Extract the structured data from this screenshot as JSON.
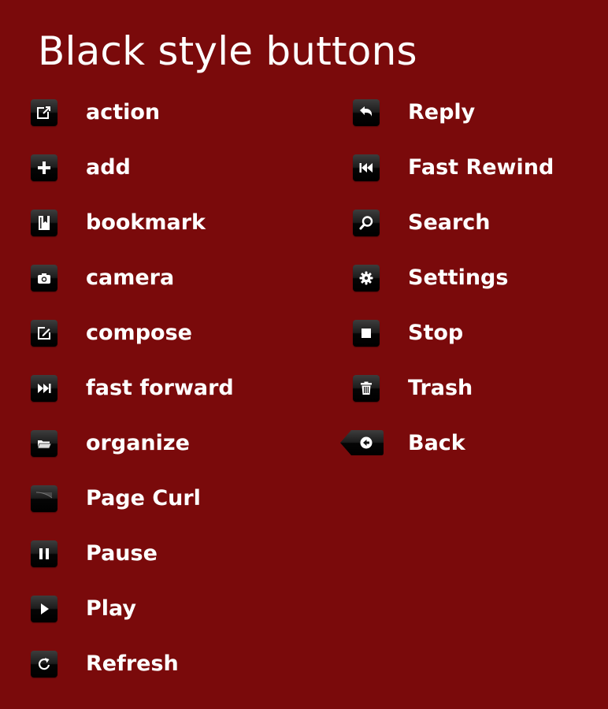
{
  "page": {
    "title": "Black style buttons",
    "background_color": "#7a0a0b"
  },
  "left_buttons": [
    {
      "label": "action",
      "icon": "action-icon"
    },
    {
      "label": "add",
      "icon": "add-icon"
    },
    {
      "label": "bookmark",
      "icon": "bookmark-icon"
    },
    {
      "label": "camera",
      "icon": "camera-icon"
    },
    {
      "label": "compose",
      "icon": "compose-icon"
    },
    {
      "label": "fast forward",
      "icon": "fast-forward-icon"
    },
    {
      "label": "organize",
      "icon": "organize-icon"
    },
    {
      "label": "Page Curl",
      "icon": "page-curl-icon"
    },
    {
      "label": "Pause",
      "icon": "pause-icon"
    },
    {
      "label": "Play",
      "icon": "play-icon"
    },
    {
      "label": "Refresh",
      "icon": "refresh-icon"
    }
  ],
  "right_buttons": [
    {
      "label": "Reply",
      "icon": "reply-icon"
    },
    {
      "label": "Fast Rewind",
      "icon": "fast-rewind-icon"
    },
    {
      "label": "Search",
      "icon": "search-icon"
    },
    {
      "label": "Settings",
      "icon": "settings-icon"
    },
    {
      "label": "Stop",
      "icon": "stop-icon"
    },
    {
      "label": "Trash",
      "icon": "trash-icon"
    },
    {
      "label": "Back",
      "icon": "back-arrow-icon"
    }
  ]
}
